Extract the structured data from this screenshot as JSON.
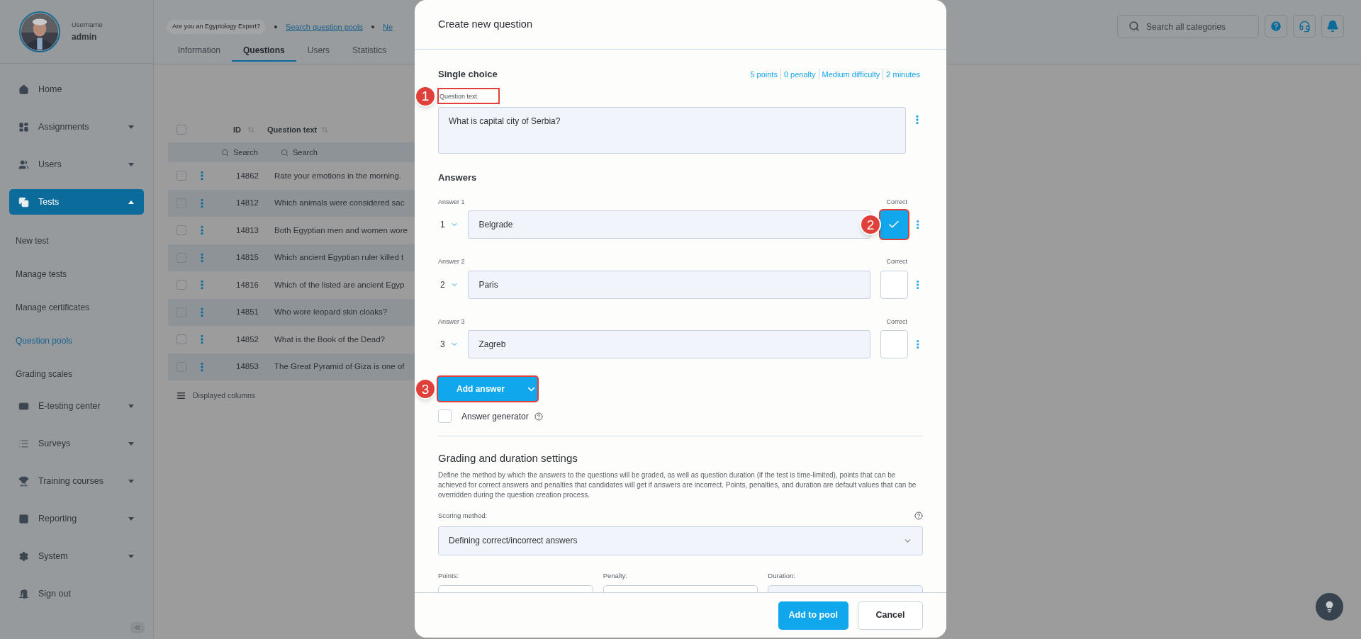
{
  "sidebar": {
    "user": {
      "caption": "Username",
      "name": "admin"
    },
    "items": [
      {
        "label": "Home",
        "kind": "link",
        "selected": false
      },
      {
        "label": "Assignments",
        "kind": "group",
        "expanded": false,
        "selected": false
      },
      {
        "label": "Users",
        "kind": "group",
        "expanded": false,
        "selected": false
      },
      {
        "label": "Tests",
        "kind": "group",
        "expanded": true,
        "selected": true,
        "children": [
          {
            "label": "New test",
            "selected": false
          },
          {
            "label": "Manage tests",
            "selected": false
          },
          {
            "label": "Manage certificates",
            "selected": false
          },
          {
            "label": "Question pools",
            "selected": true
          },
          {
            "label": "Grading scales",
            "selected": false
          }
        ]
      },
      {
        "label": "E-testing center",
        "kind": "group",
        "expanded": false,
        "selected": false
      },
      {
        "label": "Surveys",
        "kind": "group",
        "expanded": false,
        "selected": false
      },
      {
        "label": "Training courses",
        "kind": "group",
        "expanded": false,
        "selected": false
      },
      {
        "label": "Reporting",
        "kind": "group",
        "expanded": false,
        "selected": false
      },
      {
        "label": "System",
        "kind": "group",
        "expanded": false,
        "selected": false
      },
      {
        "label": "Sign out",
        "kind": "link",
        "selected": false
      }
    ]
  },
  "header": {
    "badge": "Are you an Egyptology Expert?",
    "links": [
      "Search question pools",
      "Ne"
    ],
    "tabs": [
      {
        "label": "Information",
        "selected": false
      },
      {
        "label": "Questions",
        "selected": true
      },
      {
        "label": "Users",
        "selected": false
      },
      {
        "label": "Statistics",
        "selected": false
      }
    ],
    "search": {
      "placeholder": "Search all categories"
    }
  },
  "table": {
    "all_checked": false,
    "columns": [
      "ID",
      "Question text"
    ],
    "filters": [
      "Search",
      "Search"
    ],
    "rows": [
      {
        "id": "14862",
        "text": "Rate your emotions in the morning.",
        "checked": false
      },
      {
        "id": "14812",
        "text": "Which animals were considered sac",
        "checked": false
      },
      {
        "id": "14813",
        "text": "Both Egyptian men and women wore",
        "checked": false
      },
      {
        "id": "14815",
        "text": "Which ancient Egyptian ruler killed t",
        "checked": false
      },
      {
        "id": "14816",
        "text": "Which of the listed are ancient Egyp",
        "checked": false
      },
      {
        "id": "14851",
        "text": "Who wore leopard skin cloaks?",
        "checked": false
      },
      {
        "id": "14852",
        "text": "What is the Book of the Dead?",
        "checked": false
      },
      {
        "id": "14853",
        "text": "The Great Pyramid of Giza is one of",
        "checked": false
      }
    ],
    "footer": "Displayed columns"
  },
  "modal": {
    "title": "Create new question",
    "type": "Single choice",
    "meta": [
      "5 points",
      "0 penalty",
      "Medium difficulty",
      "2 minutes"
    ],
    "question": {
      "label": "Question text",
      "value": "What is capital city of Serbia?",
      "callout": "1"
    },
    "answers_title": "Answers",
    "answers": [
      {
        "label": "Answer 1",
        "number": "1",
        "value": "Belgrade",
        "correct_label": "Correct",
        "correct": true,
        "callout": "2"
      },
      {
        "label": "Answer 2",
        "number": "2",
        "value": "Paris",
        "correct_label": "Correct",
        "correct": false
      },
      {
        "label": "Answer 3",
        "number": "3",
        "value": "Zagreb",
        "correct_label": "Correct",
        "correct": false
      }
    ],
    "add_answer": {
      "label": "Add answer",
      "callout": "3"
    },
    "generator": {
      "label": "Answer generator",
      "checked": false
    },
    "grading": {
      "title": "Grading and duration settings",
      "description": "Define the method by which the answers to the questions will be graded, as well as question duration (if the test is time-limited), points that can be achieved for correct answers and penalties that candidates will get if answers are incorrect. Points, penalties, and duration are default values that can be overridden during the question creation process.",
      "scoring": {
        "label": "Scoring method:",
        "value": "Defining correct/incorrect answers"
      },
      "fields": [
        "Points:",
        "Penalty:",
        "Duration:"
      ]
    },
    "buttons": {
      "primary": "Add to pool",
      "secondary": "Cancel"
    }
  }
}
